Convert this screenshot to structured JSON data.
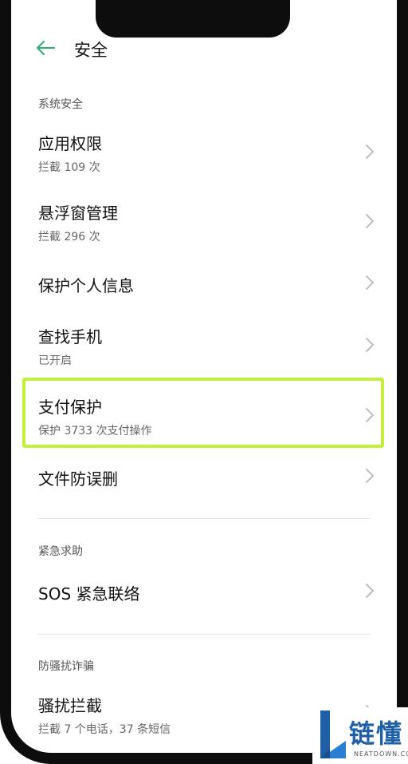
{
  "header": {
    "title": "安全",
    "back_icon": "arrow-left-icon",
    "accent_color": "#3aa97c"
  },
  "sections": {
    "system_security": "系统安全",
    "emergency": "紧急求助",
    "anti_fraud": "防骚扰诈骗"
  },
  "items": {
    "app_permissions": {
      "title": "应用权限",
      "sub": "拦截 109 次"
    },
    "floating_window": {
      "title": "悬浮窗管理",
      "sub": "拦截 296 次"
    },
    "personal_info": {
      "title": "保护个人信息"
    },
    "find_phone": {
      "title": "查找手机",
      "sub": "已开启"
    },
    "payment_protection": {
      "title": "支付保护",
      "sub": "保护 3733 次支付操作"
    },
    "file_protection": {
      "title": "文件防误删"
    },
    "sos": {
      "title": "SOS 紧急联络"
    },
    "harassment": {
      "title": "骚扰拦截",
      "sub": "拦截 7 个电话，37 条短信"
    }
  },
  "highlight_color": "#c5f03a",
  "watermark": {
    "text": "链懂",
    "domain": "NEATDOWN.COM",
    "color": "#1f5fa6"
  }
}
